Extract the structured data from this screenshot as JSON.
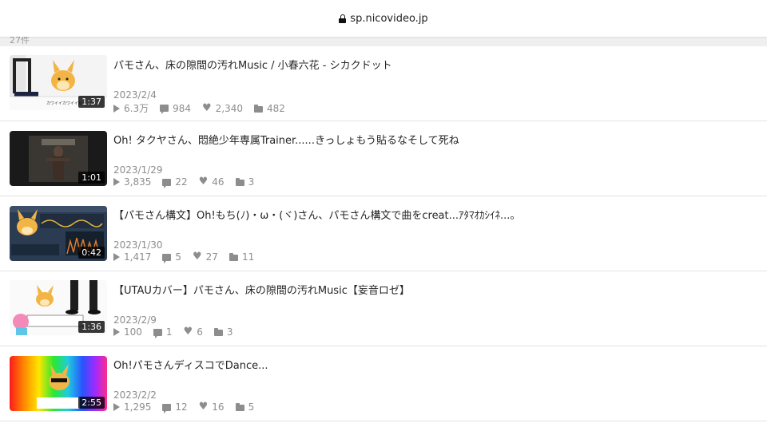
{
  "browser": {
    "url": "sp.nicovideo.jp"
  },
  "list_header": {
    "count": "27件"
  },
  "videos": [
    {
      "title": "パモさん、床の隙間の汚れMusic / 小春六花 - シカクドット",
      "date": "2023/2/4",
      "duration": "1:37",
      "views": "6.3万",
      "comments": "984",
      "likes": "2,340",
      "mylists": "482",
      "thumb_lines": [
        "カワイイ",
        "カワイイね"
      ]
    },
    {
      "title": "Oh! タクヤさん、悶絶少年専属Trainer......きっしょもう貼るなそして死ね",
      "date": "2023/1/29",
      "duration": "1:01",
      "views": "3,835",
      "comments": "22",
      "likes": "46",
      "mylists": "3"
    },
    {
      "title": "【パモさん構文】Oh!もち(ﾉ)・ω・(ヾ)さん、パモさん構文で曲をcreat...ｱﾀﾏｵｶｼｲﾈ...。",
      "date": "2023/1/30",
      "duration": "0:42",
      "views": "1,417",
      "comments": "5",
      "likes": "27",
      "mylists": "11"
    },
    {
      "title": "【UTAUカバー】パモさん、床の隙間の汚れMusic【妄音ロゼ】",
      "date": "2023/2/9",
      "duration": "1:36",
      "views": "100",
      "comments": "1",
      "likes": "6",
      "mylists": "3"
    },
    {
      "title": "Oh!パモさんディスコでDance...",
      "date": "2023/2/2",
      "duration": "2:55",
      "views": "1,295",
      "comments": "12",
      "likes": "16",
      "mylists": "5"
    }
  ],
  "colors": {
    "meta_gray": "#8d8d8d",
    "divider": "#e3e3e3",
    "title_text": "#252525"
  }
}
